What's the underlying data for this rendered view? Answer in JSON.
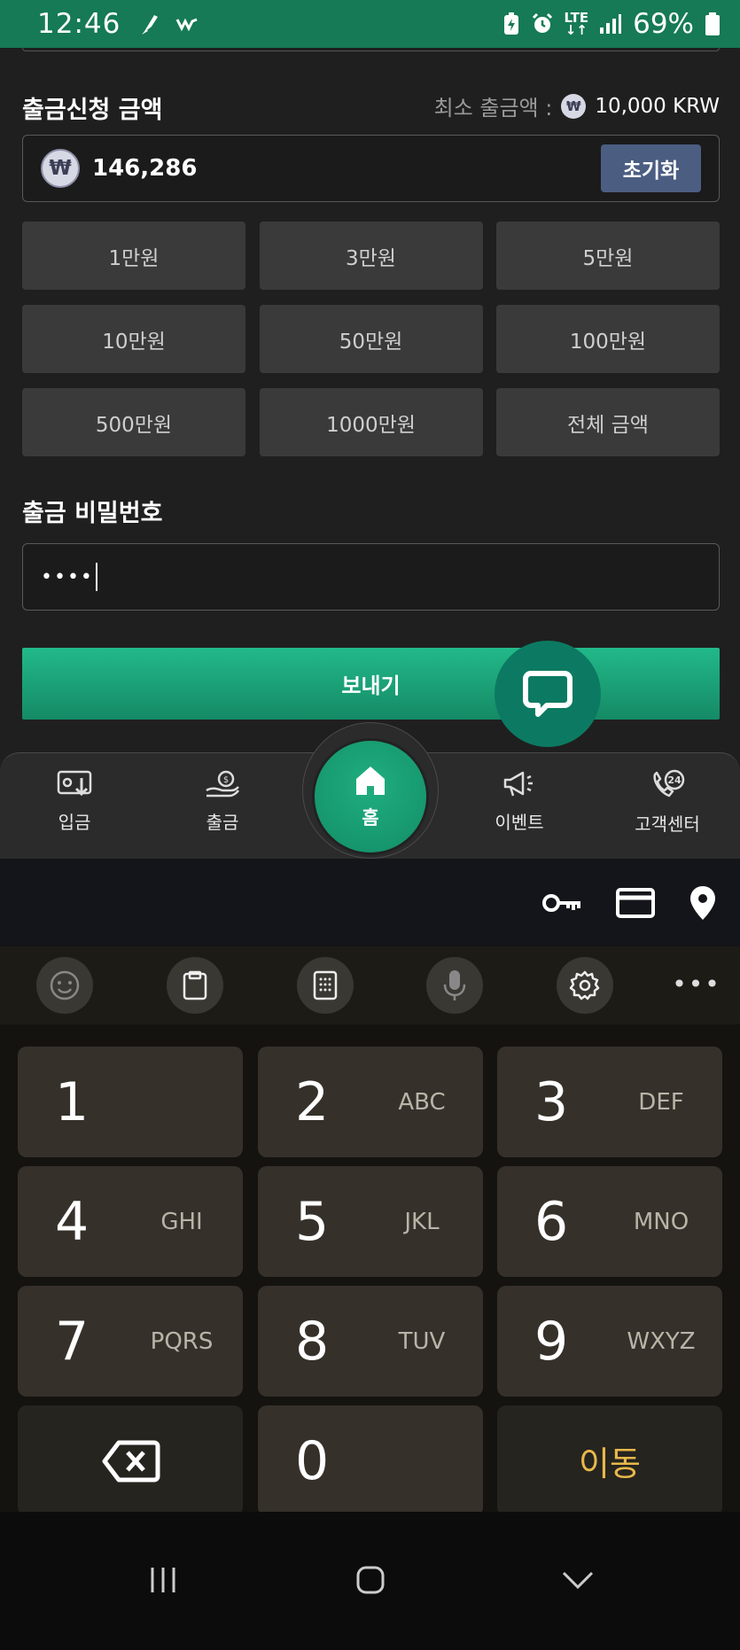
{
  "status_bar": {
    "time": "12:46",
    "battery_pct": "69%",
    "network": "LTE"
  },
  "withdraw": {
    "amount_title": "출금신청 금액",
    "min_label": "최소 출금액 :",
    "min_value": "10,000 KRW",
    "currency_symbol": "₩",
    "amount_value": "146,286",
    "reset_label": "초기화",
    "quick_amounts": [
      "1만원",
      "3만원",
      "5만원",
      "10만원",
      "50만원",
      "100만원",
      "500만원",
      "1000만원",
      "전체 금액"
    ],
    "password_title": "출금 비밀번호",
    "password_value": "••••",
    "send_label": "보내기"
  },
  "bottom_nav": {
    "deposit": "입금",
    "withdraw": "출금",
    "home": "홈",
    "event": "이벤트",
    "support": "고객센터"
  },
  "keypad": {
    "keys": [
      {
        "digit": "1",
        "letters": ""
      },
      {
        "digit": "2",
        "letters": "ABC"
      },
      {
        "digit": "3",
        "letters": "DEF"
      },
      {
        "digit": "4",
        "letters": "GHI"
      },
      {
        "digit": "5",
        "letters": "JKL"
      },
      {
        "digit": "6",
        "letters": "MNO"
      },
      {
        "digit": "7",
        "letters": "PQRS"
      },
      {
        "digit": "8",
        "letters": "TUV"
      },
      {
        "digit": "9",
        "letters": "WXYZ"
      },
      {
        "digit": "0",
        "letters": ""
      }
    ],
    "go_label": "이동"
  },
  "colors": {
    "accent_green": "#1fae80",
    "status_green": "#157a55",
    "reset_blue": "#4b5e82",
    "go_gold": "#e8b84a"
  }
}
